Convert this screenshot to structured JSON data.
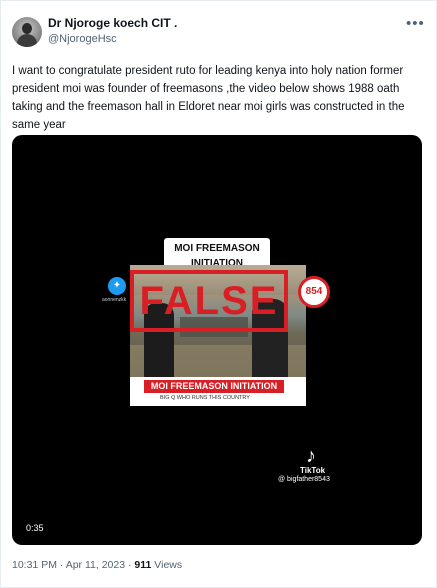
{
  "tweet": {
    "author_name": "Dr Njoroge koech CIT .",
    "handle": "@NjorogeHsc",
    "more_icon": "more-horizontal-icon",
    "text": "I want to congratulate president ruto for leading kenya into holy nation former president moi was founder of freemasons ,the video below shows 1988 oath taking and the freemason hall in Eldoret near moi girls was constructed in the same year",
    "time": "10:31 PM",
    "date": "Apr 11, 2023",
    "views_count": "911",
    "views_label": "Views"
  },
  "video": {
    "title_line1": "MOI FREEMASON",
    "title_line2": "INITIATION",
    "stamp": "FALSE",
    "stamp_color": "#d81f26",
    "twitter_badge_label": "aonnenzkk",
    "badge_854": "854",
    "caption": "MOI FREEMASON INITIATION",
    "caption_sub": "BIG Q    WHO RUNS THIS COUNTRY",
    "tiktok_label": "TikTok",
    "tiktok_handle": "@ bigfather8543",
    "duration": "0:35"
  },
  "colors": {
    "muted": "#536471",
    "text": "#0f1419"
  }
}
